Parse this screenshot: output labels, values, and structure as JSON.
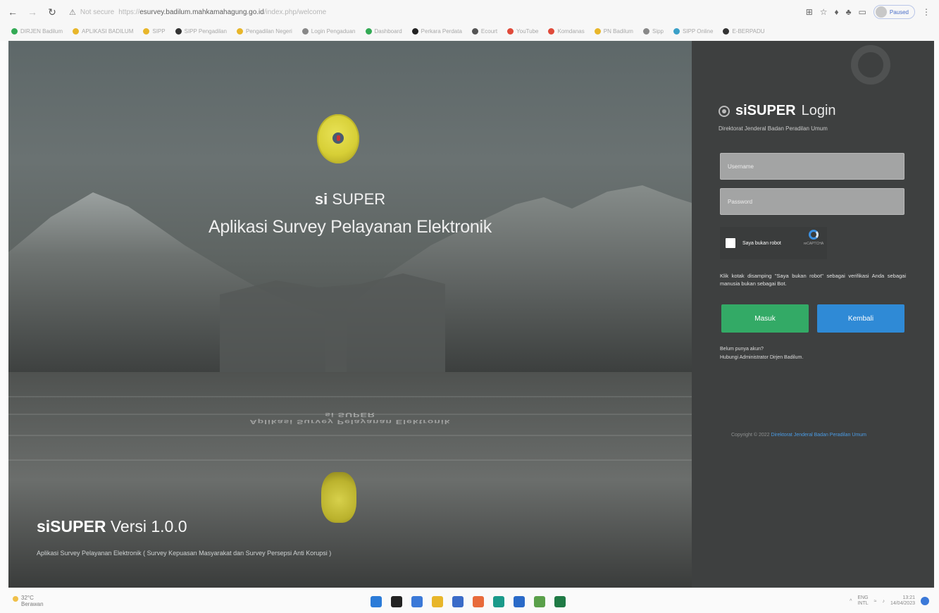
{
  "browser": {
    "back_icon": "back-arrow-icon",
    "forward_icon": "forward-arrow-icon",
    "reload_icon": "reload-icon",
    "security_label": "Not secure",
    "url_scheme": "https://",
    "url_host": "esurvey.badilum.mahkamahagung.go.id",
    "url_path": "/index.php/welcome",
    "profile_label": "Paused",
    "bookmarks": [
      {
        "label": "DIRJEN Badilum",
        "color": "#33aa55"
      },
      {
        "label": "APLIKASI BADILUM",
        "color": "#e8b62a"
      },
      {
        "label": "SIPP",
        "color": "#e8b62a"
      },
      {
        "label": "SIPP Pengadilan",
        "color": "#333333"
      },
      {
        "label": "Pengadilan Negeri",
        "color": "#e8b62a"
      },
      {
        "label": "Login Pengaduan",
        "color": "#888888"
      },
      {
        "label": "Dashboard",
        "color": "#33aa55"
      },
      {
        "label": "Perkara Perdata",
        "color": "#222222"
      },
      {
        "label": "Ecourt",
        "color": "#555555"
      },
      {
        "label": "YouTube",
        "color": "#e04a3a"
      },
      {
        "label": "Komdanas",
        "color": "#e04a3a"
      },
      {
        "label": "PN Badilum",
        "color": "#e8b62a"
      },
      {
        "label": "Sipp",
        "color": "#888888"
      },
      {
        "label": "SIPP Online",
        "color": "#3aa0c8"
      },
      {
        "label": "E-BERPADU",
        "color": "#333333"
      }
    ]
  },
  "hero": {
    "app_short_bold": "si",
    "app_short_rest": " SUPER",
    "app_full": "Aplikasi Survey Pelayanan Elektronik",
    "reflection_lines": [
      "Aplikasi Survey Pelayanan Elektronik",
      "si SUPER"
    ],
    "version_brand": "siSUPER",
    "version_text": " Versi 1.0.0",
    "tagline": "Aplikasi Survey Pelayanan Elektronik ( Survey Kepuasan Masyarakat dan Survey Persepsi Anti Korupsi )"
  },
  "login": {
    "title_brand": "siSUPER",
    "title_word": "Login",
    "subtitle": "Direktorat Jenderal Badan Peradilan Umum",
    "username_placeholder": "Username",
    "password_placeholder": "Password",
    "captcha_label": "Saya bukan robot",
    "captcha_brand": "reCAPTCHA",
    "notice": "Klik kotak disamping \"Saya bukan robot\" sebagai verifikasi Anda sebagai manusia bukan sebagai Bot.",
    "submit_label": "Masuk",
    "back_label": "Kembali",
    "register_q": "Belum punya akun?",
    "register_hint": "Hubungi Administrator Dirjen Badilum.",
    "copyright_prefix": "Copyright © 2022 ",
    "copyright_org": "Direktorat Jenderal Badan Peradilan Umum"
  },
  "taskbar": {
    "weather_temp": "32°C",
    "weather_desc": "Berawan",
    "tray_time": "13:21",
    "tray_date": "14/04/2023",
    "tray_lang": "ENG\nINTL",
    "apps": [
      {
        "name": "start-icon",
        "color": "#2b7bd8"
      },
      {
        "name": "search-icon",
        "color": "#222222"
      },
      {
        "name": "chat-icon",
        "color": "#3b79d8"
      },
      {
        "name": "file-explorer-icon",
        "color": "#e8b62a"
      },
      {
        "name": "store-icon",
        "color": "#3a6bc8"
      },
      {
        "name": "app-icon",
        "color": "#e86a3a"
      },
      {
        "name": "edge-icon",
        "color": "#1a9a8a"
      },
      {
        "name": "mail-icon",
        "color": "#2a6ac8"
      },
      {
        "name": "chrome-icon",
        "color": "#5aa04a"
      },
      {
        "name": "excel-icon",
        "color": "#1f7a45"
      }
    ]
  }
}
